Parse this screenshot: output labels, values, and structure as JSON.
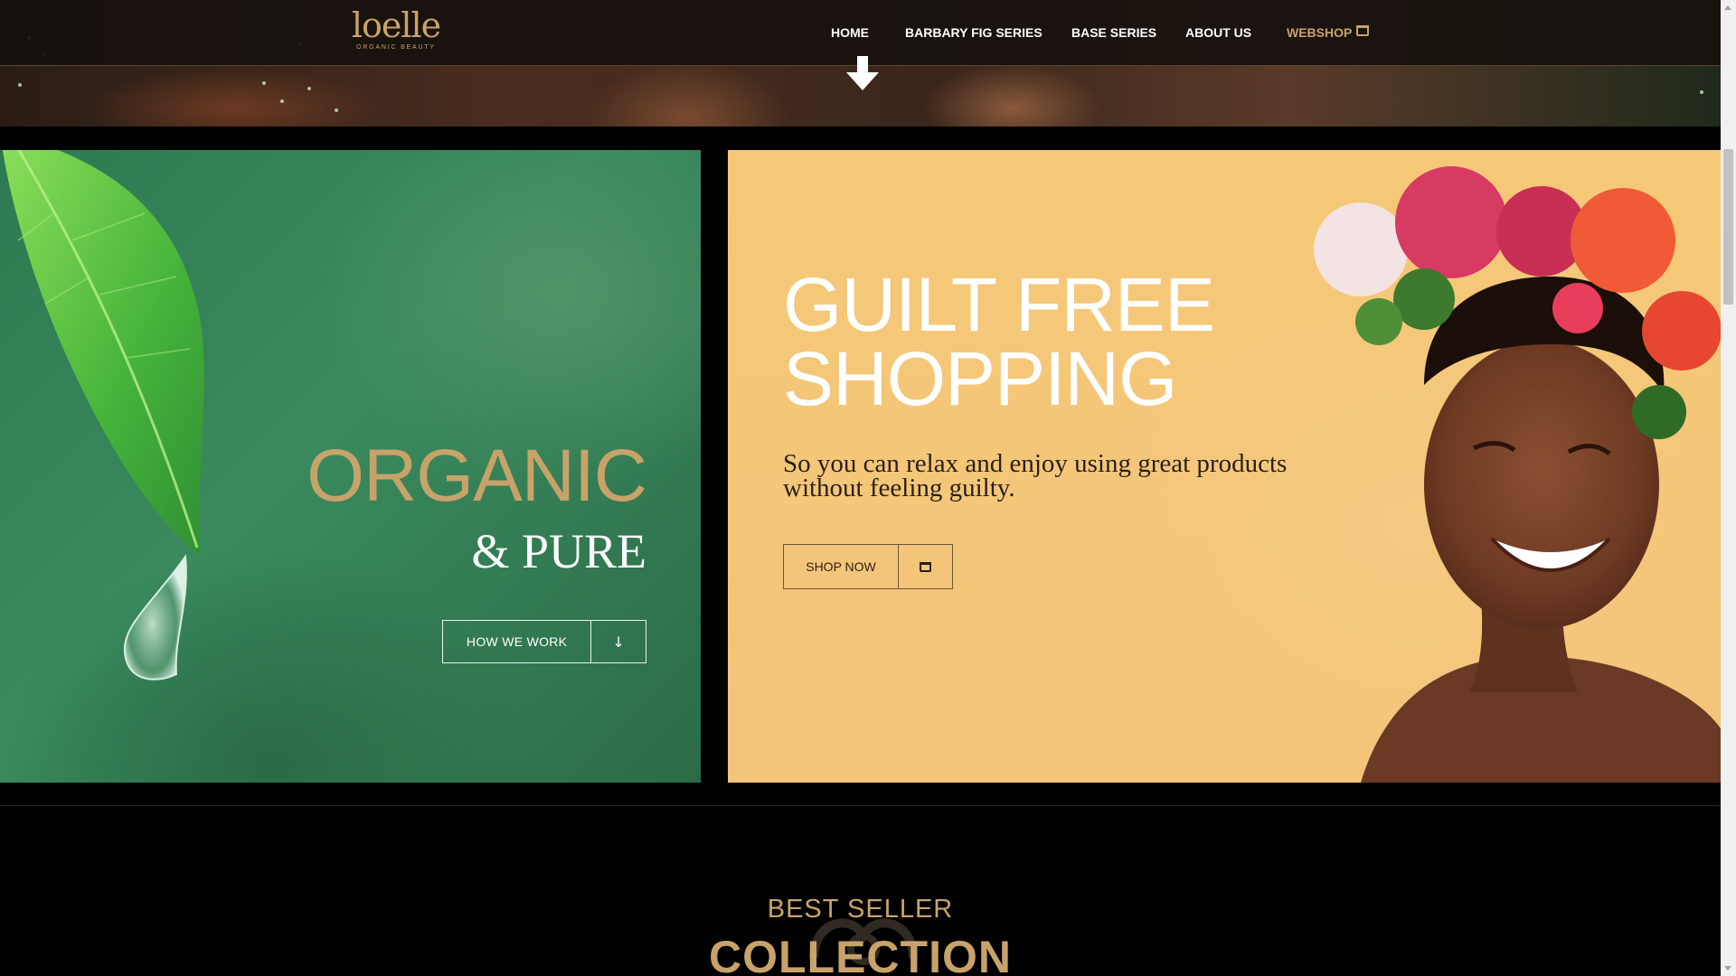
{
  "brand": {
    "logo_word": "loelle",
    "logo_tagline": "ORGANIC BEAUTY",
    "accent_color": "#c8a369"
  },
  "nav": {
    "items": [
      {
        "label": "HOME"
      },
      {
        "label": "BARBARY FIG SERIES"
      },
      {
        "label": "BASE SERIES"
      },
      {
        "label": "ABOUT US"
      },
      {
        "label": "WEBSHOP",
        "icon": "cart-icon"
      }
    ]
  },
  "hero": {
    "scroll_icon": "arrow-down-icon"
  },
  "organic_card": {
    "title": "ORGANIC",
    "subtitle": "& PURE",
    "button_label": "HOW WE WORK",
    "button_icon": "arrow-down-icon",
    "button_glyph": "↓"
  },
  "guilt_card": {
    "title_line1": "GUILT FREE",
    "title_line2": "SHOPPING",
    "description": "So you can relax and enjoy using great products without feeling guilty.",
    "button_label": "SHOP NOW",
    "button_icon": "cart-icon"
  },
  "bestseller": {
    "kicker": "BEST SELLER",
    "title": "COLLECTION"
  }
}
